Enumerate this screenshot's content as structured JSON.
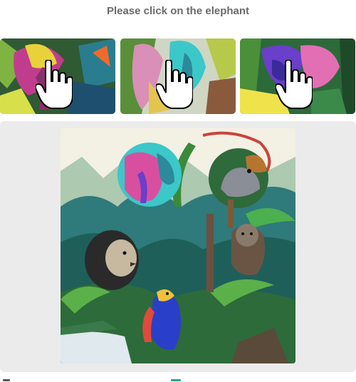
{
  "instruction": "Please click on the elephant",
  "thumbnails": [
    {
      "subject": "elephant",
      "palette": [
        "#3d6b3a",
        "#e8d23a",
        "#c03d8e",
        "#2a7d8e"
      ]
    },
    {
      "subject": "elephant",
      "palette": [
        "#d98fb7",
        "#3cc7c9",
        "#b7c94a",
        "#8a5a3c"
      ]
    },
    {
      "subject": "elephant",
      "palette": [
        "#6a3fc9",
        "#e26fb4",
        "#2c8a4a",
        "#f0e24a"
      ]
    }
  ],
  "scene": {
    "subjects": [
      "elephant",
      "squirrel",
      "lion",
      "bear",
      "parrot"
    ]
  },
  "colors": {
    "instruction_text": "#6b6b6b",
    "panel_bg": "#ebebeb"
  }
}
